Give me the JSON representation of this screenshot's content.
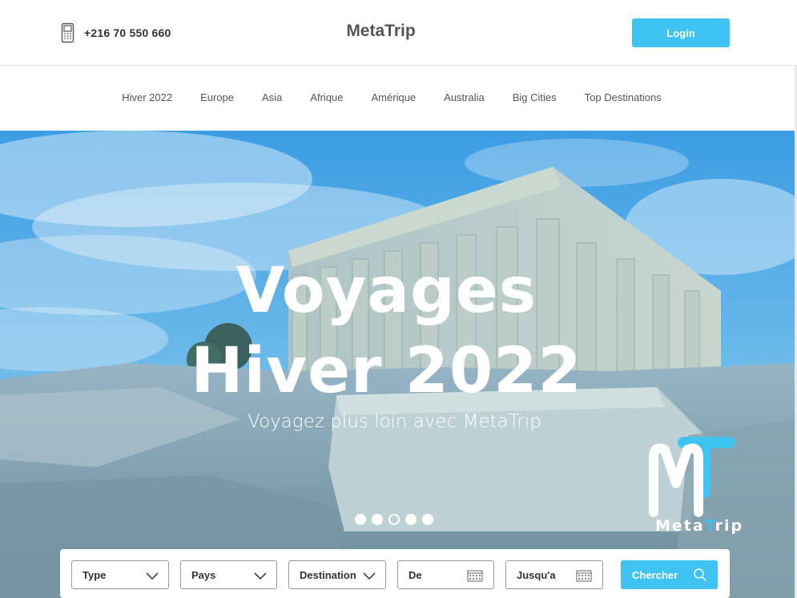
{
  "header": {
    "phone": "+216 70 550 660",
    "brand": "MetaTrip",
    "login_label": "Login"
  },
  "nav": {
    "items": [
      "Hiver 2022",
      "Europe",
      "Asia",
      "Afrique",
      "Amérique",
      "Australia",
      "Big Cities",
      "Top Destinations"
    ]
  },
  "hero": {
    "title_line1": "Voyages",
    "title_line2": "Hiver 2022",
    "subtitle": "Voyagez plus loin avec MetaTrip",
    "logo_text_pre": "Meta",
    "logo_text_t": "T",
    "logo_text_post": "rip",
    "slides_count": 5,
    "active_slide": 3
  },
  "search": {
    "type_label": "Type",
    "country_label": "Pays",
    "destination_label": "Destination",
    "from_label": "De",
    "to_label": "Jusqu'a",
    "submit_label": "Chercher"
  },
  "colors": {
    "accent": "#3ec3f2",
    "sky": "#4aa8e8",
    "text": "#333333"
  },
  "icons": {
    "phone": "phone-icon",
    "dropdown": "chevron-down-icon",
    "calendar": "calendar-icon",
    "search": "search-icon"
  }
}
